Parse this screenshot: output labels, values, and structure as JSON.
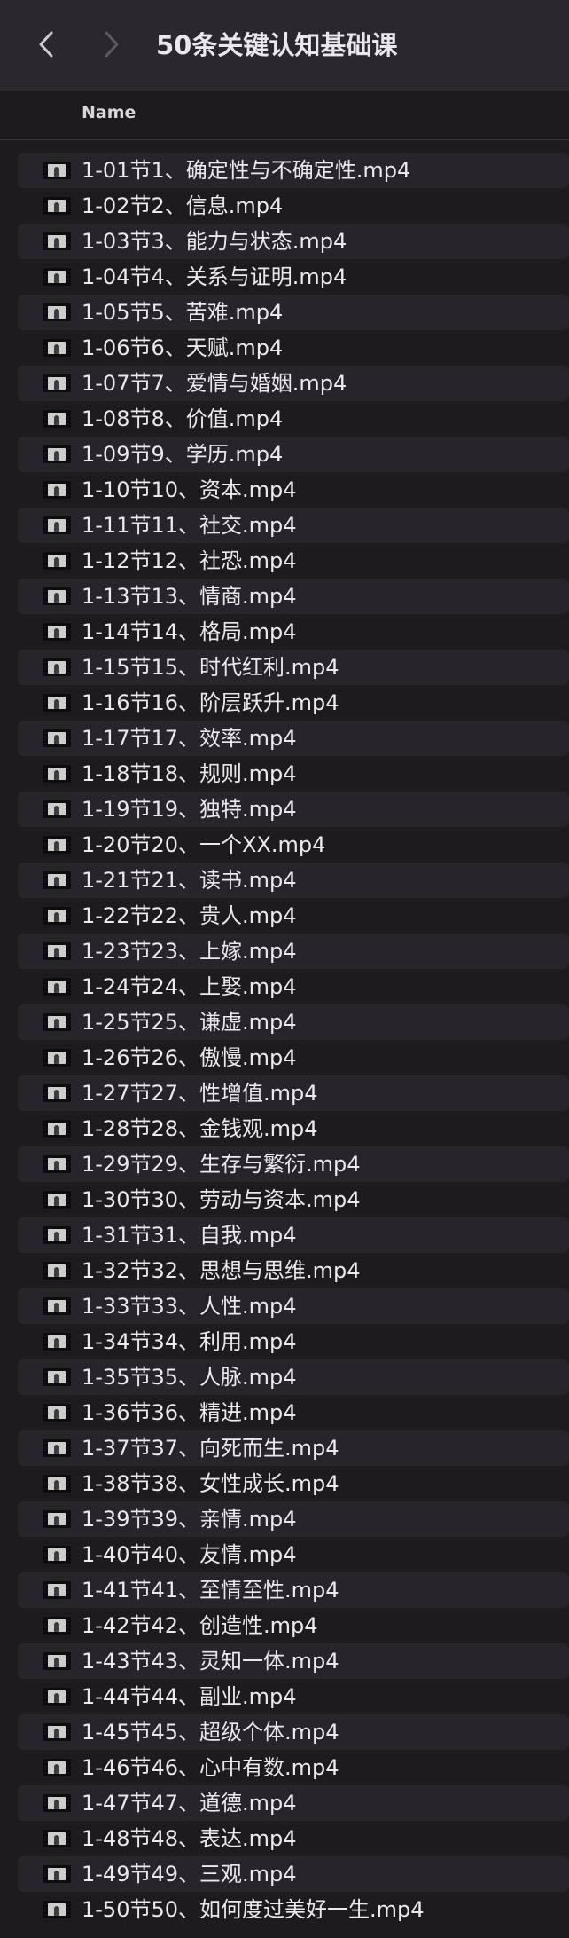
{
  "window": {
    "title": "50条关键认知基础课"
  },
  "header": {
    "name_column": "Name"
  },
  "files": [
    "1-01节1、确定性与不确定性.mp4",
    "1-02节2、信息.mp4",
    "1-03节3、能力与状态.mp4",
    "1-04节4、关系与证明.mp4",
    "1-05节5、苦难.mp4",
    "1-06节6、天赋.mp4",
    "1-07节7、爱情与婚姻.mp4",
    "1-08节8、价值.mp4",
    "1-09节9、学历.mp4",
    "1-10节10、资本.mp4",
    "1-11节11、社交.mp4",
    "1-12节12、社恐.mp4",
    "1-13节13、情商.mp4",
    "1-14节14、格局.mp4",
    "1-15节15、时代红利.mp4",
    "1-16节16、阶层跃升.mp4",
    "1-17节17、效率.mp4",
    "1-18节18、规则.mp4",
    "1-19节19、独特.mp4",
    "1-20节20、一个XX.mp4",
    "1-21节21、读书.mp4",
    "1-22节22、贵人.mp4",
    "1-23节23、上嫁.mp4",
    "1-24节24、上娶.mp4",
    "1-25节25、谦虚.mp4",
    "1-26节26、傲慢.mp4",
    "1-27节27、性增值.mp4",
    "1-28节28、金钱观.mp4",
    "1-29节29、生存与繁衍.mp4",
    "1-30节30、劳动与资本.mp4",
    "1-31节31、自我.mp4",
    "1-32节32、思想与思维.mp4",
    "1-33节33、人性.mp4",
    "1-34节34、利用.mp4",
    "1-35节35、人脉.mp4",
    "1-36节36、精进.mp4",
    "1-37节37、向死而生.mp4",
    "1-38节38、女性成长.mp4",
    "1-39节39、亲情.mp4",
    "1-40节40、友情.mp4",
    "1-41节41、至情至性.mp4",
    "1-42节42、创造性.mp4",
    "1-43节43、灵知一体.mp4",
    "1-44节44、副业.mp4",
    "1-45节45、超级个体.mp4",
    "1-46节46、心中有数.mp4",
    "1-47节47、道德.mp4",
    "1-48节48、表达.mp4",
    "1-49节49、三观.mp4",
    "1-50节50、如何度过美好一生.mp4"
  ]
}
